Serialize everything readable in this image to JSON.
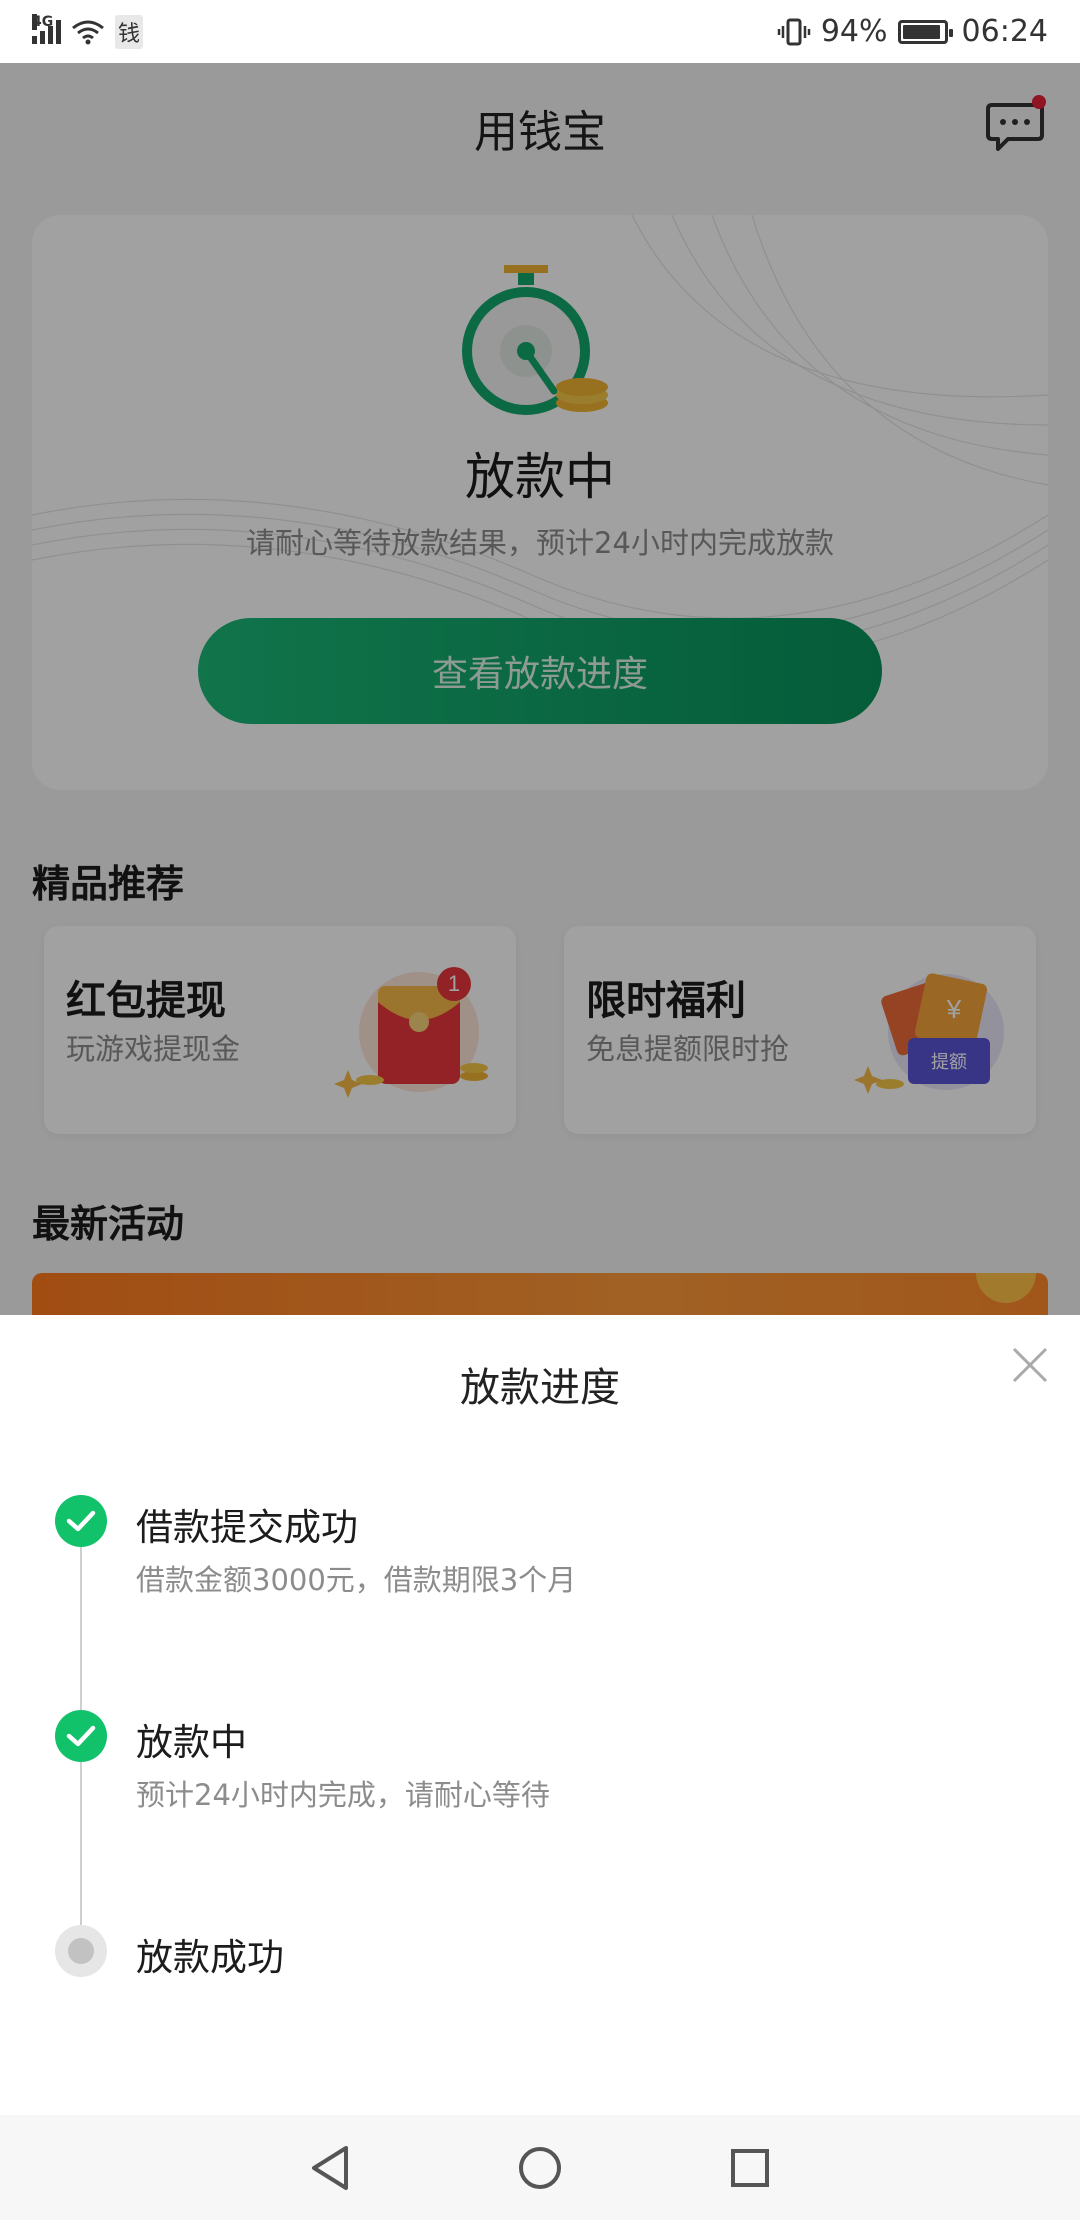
{
  "status_bar": {
    "network": "4G",
    "app_badge": "钱",
    "battery": "94%",
    "time": "06:24",
    "icons": [
      "signal-icon",
      "wifi-icon",
      "vibrate-icon",
      "battery-icon"
    ]
  },
  "header": {
    "title": "用钱宝"
  },
  "status_card": {
    "title": "放款中",
    "subtitle": "请耐心等待放款结果，预计24小时内完成放款",
    "button_label": "查看放款进度"
  },
  "recommend": {
    "title": "精品推荐",
    "items": [
      {
        "title": "红包提现",
        "subtitle": "玩游戏提现金",
        "badge": "1"
      },
      {
        "title": "限时福利",
        "subtitle": "免息提额限时抢",
        "art_label": "提额",
        "art_symbol": "¥"
      }
    ]
  },
  "activities": {
    "title": "最新活动"
  },
  "sheet": {
    "title": "放款进度",
    "steps": [
      {
        "title": "借款提交成功",
        "desc": "借款金额3000元，借款期限3个月",
        "state": "done"
      },
      {
        "title": "放款中",
        "desc": "预计24小时内完成，请耐心等待",
        "state": "done"
      },
      {
        "title": "放款成功",
        "desc": "",
        "state": "pending"
      }
    ]
  },
  "colors": {
    "accent": "#12c26a",
    "button": "#0f9f63",
    "overlay": "rgba(0,0,0,0.37)"
  }
}
